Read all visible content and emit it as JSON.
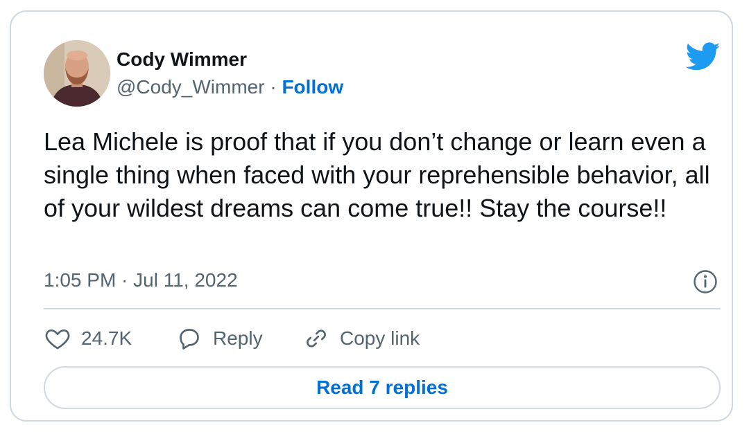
{
  "author": {
    "display_name": "Cody Wimmer",
    "handle": "@Cody_Wimmer",
    "separator": "·",
    "follow_label": "Follow",
    "avatar_icon": "profile-photo"
  },
  "brand": {
    "icon": "twitter-bird-icon",
    "color": "#1d9bf0"
  },
  "tweet": {
    "text": "Lea Michele is proof that if you don’t change or learn even a single thing when faced with your reprehensible behavior, all of your wildest dreams can come true!! Stay the course!!",
    "timestamp": "1:05 PM · Jul 11, 2022"
  },
  "actions": {
    "like_count": "24.7K",
    "reply_label": "Reply",
    "copy_link_label": "Copy link"
  },
  "read_replies_label": "Read 7 replies",
  "colors": {
    "link": "#006fd6",
    "secondary_text": "#536471",
    "border": "#cfd9de",
    "text": "#0f1419"
  }
}
